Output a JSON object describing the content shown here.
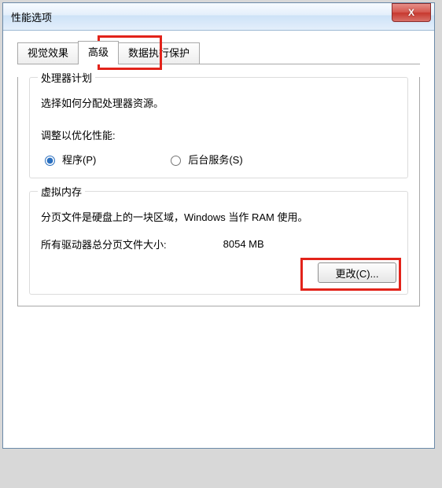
{
  "window": {
    "title": "性能选项",
    "close_label": "X"
  },
  "tabs": {
    "visual": "视觉效果",
    "advanced": "高级",
    "dep": "数据执行保护"
  },
  "processor": {
    "group_title": "处理器计划",
    "desc": "选择如何分配处理器资源。",
    "adjust_label": "调整以优化性能:",
    "radio_programs": "程序(P)",
    "radio_services": "后台服务(S)"
  },
  "vm": {
    "group_title": "虚拟内存",
    "desc": "分页文件是硬盘上的一块区域，Windows 当作 RAM 使用。",
    "total_label": "所有驱动器总分页文件大小:",
    "total_value": "8054 MB",
    "change_btn": "更改(C)..."
  }
}
